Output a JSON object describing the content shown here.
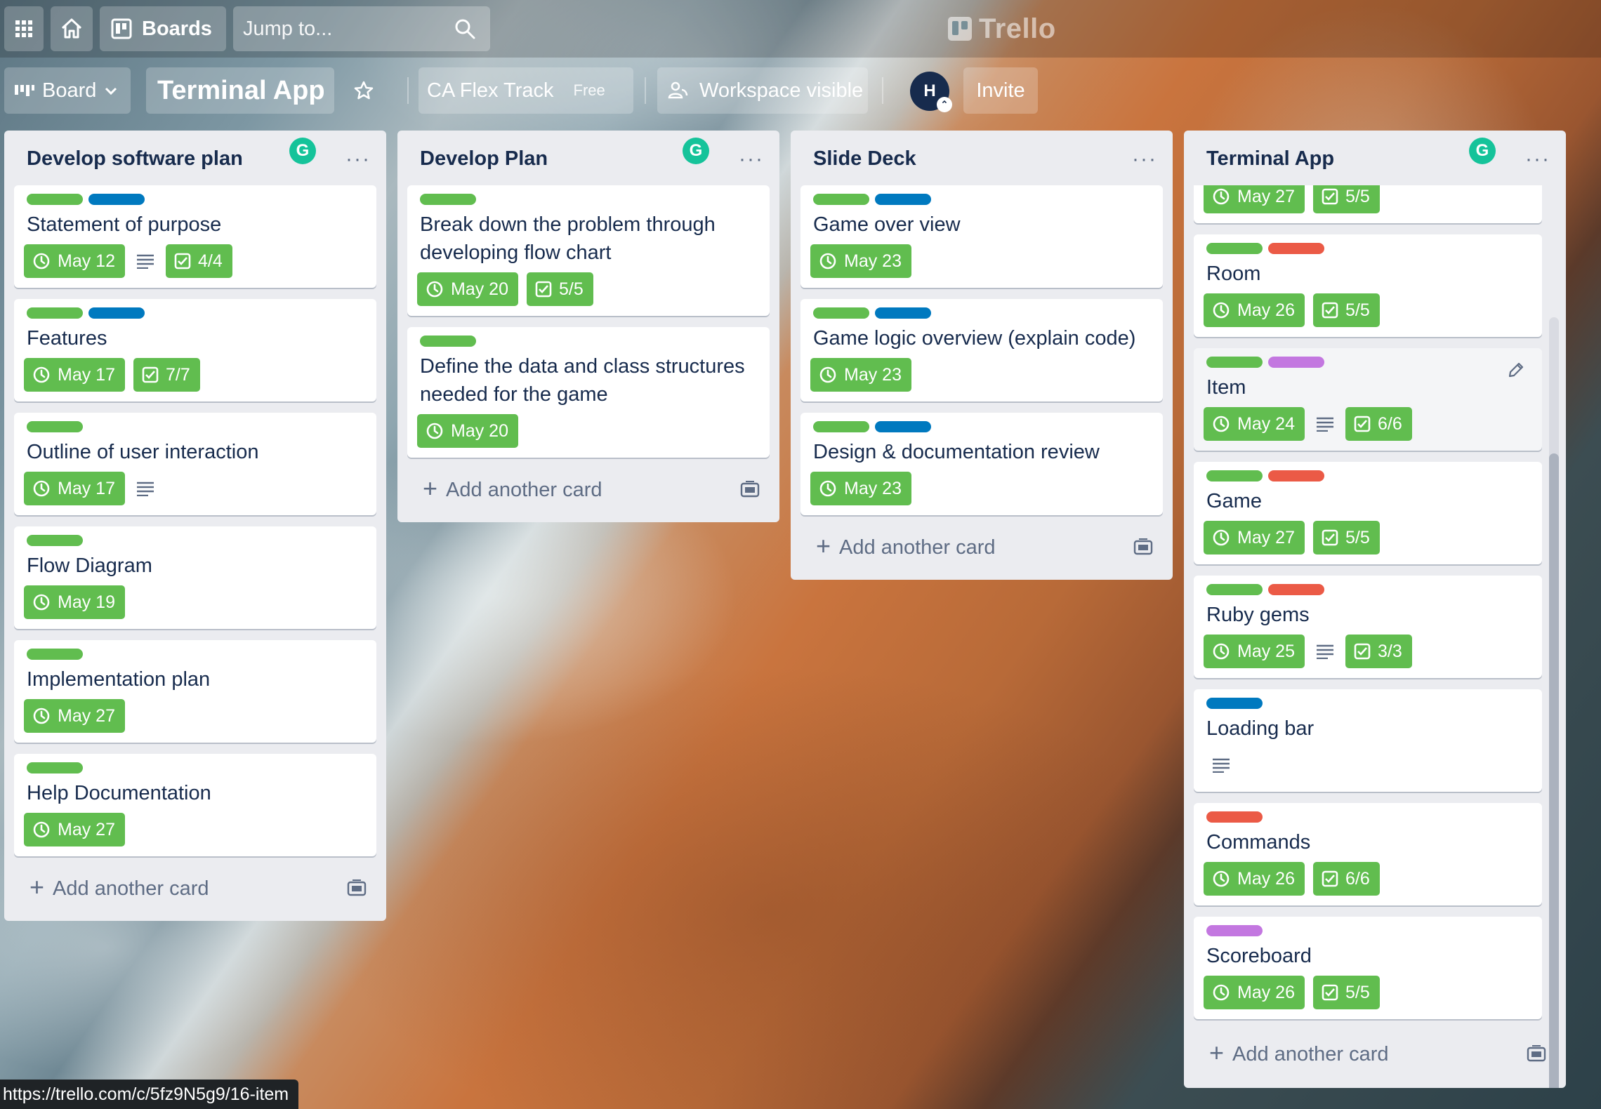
{
  "header": {
    "boards_label": "Boards",
    "search_placeholder": "Jump to...",
    "logo_text": "Trello"
  },
  "board": {
    "view_label": "Board",
    "title": "Terminal App",
    "workspace": "CA Flex Track",
    "plan": "Free",
    "visibility": "Workspace visible",
    "avatar_initial": "H",
    "invite_label": "Invite"
  },
  "colors": {
    "green": "#61bd4f",
    "blue": "#0079bf",
    "red": "#eb5a46",
    "purple": "#c377e0",
    "badge_green": "#61bd4f"
  },
  "add_card_label": "Add another card",
  "lists": [
    {
      "title": "Develop software plan",
      "cards": [
        {
          "title": "Statement of purpose",
          "labels": [
            "green",
            "blue"
          ],
          "due": "May 12",
          "desc": true,
          "checklist": "4/4"
        },
        {
          "title": "Features",
          "labels": [
            "green",
            "blue"
          ],
          "due": "May 17",
          "desc": false,
          "checklist": "7/7"
        },
        {
          "title": "Outline of user interaction",
          "labels": [
            "green"
          ],
          "due": "May 17",
          "desc": true,
          "checklist": ""
        },
        {
          "title": "Flow Diagram",
          "labels": [
            "green"
          ],
          "due": "May 19",
          "desc": false,
          "checklist": ""
        },
        {
          "title": "Implementation plan",
          "labels": [
            "green"
          ],
          "due": "May 27",
          "desc": false,
          "checklist": ""
        },
        {
          "title": "Help Documentation",
          "labels": [
            "green"
          ],
          "due": "May 27",
          "desc": false,
          "checklist": ""
        }
      ]
    },
    {
      "title": "Develop Plan",
      "cards": [
        {
          "title": "Break down the problem through developing flow chart",
          "labels": [
            "green"
          ],
          "due": "May 20",
          "desc": false,
          "checklist": "5/5"
        },
        {
          "title": "Define the data and class structures needed for the game",
          "labels": [
            "green"
          ],
          "due": "May 20",
          "desc": false,
          "checklist": ""
        }
      ]
    },
    {
      "title": "Slide Deck",
      "cards": [
        {
          "title": "Game over view",
          "labels": [
            "green",
            "blue"
          ],
          "due": "May 23",
          "desc": false,
          "checklist": ""
        },
        {
          "title": "Game logic overview (explain code)",
          "labels": [
            "green",
            "blue"
          ],
          "due": "May 23",
          "desc": false,
          "checklist": ""
        },
        {
          "title": "Design & documentation review",
          "labels": [
            "green",
            "blue"
          ],
          "due": "May 23",
          "desc": false,
          "checklist": ""
        }
      ]
    },
    {
      "title": "Terminal App",
      "cards": [
        {
          "title": "",
          "labels": [],
          "due": "May 27",
          "desc": false,
          "checklist": "5/5"
        },
        {
          "title": "Room",
          "labels": [
            "green",
            "red"
          ],
          "due": "May 26",
          "desc": false,
          "checklist": "5/5"
        },
        {
          "title": "Item",
          "labels": [
            "green",
            "purple"
          ],
          "due": "May 24",
          "desc": true,
          "checklist": "6/6"
        },
        {
          "title": "Game",
          "labels": [
            "green",
            "red"
          ],
          "due": "May 27",
          "desc": false,
          "checklist": "5/5"
        },
        {
          "title": "Ruby gems",
          "labels": [
            "green",
            "red"
          ],
          "due": "May 25",
          "desc": true,
          "checklist": "3/3"
        },
        {
          "title": "Loading bar",
          "labels": [
            "blue"
          ],
          "due": "",
          "desc": true,
          "checklist": ""
        },
        {
          "title": "Commands",
          "labels": [
            "red"
          ],
          "due": "May 26",
          "desc": false,
          "checklist": "6/6"
        },
        {
          "title": "Scoreboard",
          "labels": [
            "purple"
          ],
          "due": "May 26",
          "desc": false,
          "checklist": "5/5"
        }
      ]
    }
  ],
  "status_url": "https://trello.com/c/5fz9N5g9/16-item"
}
